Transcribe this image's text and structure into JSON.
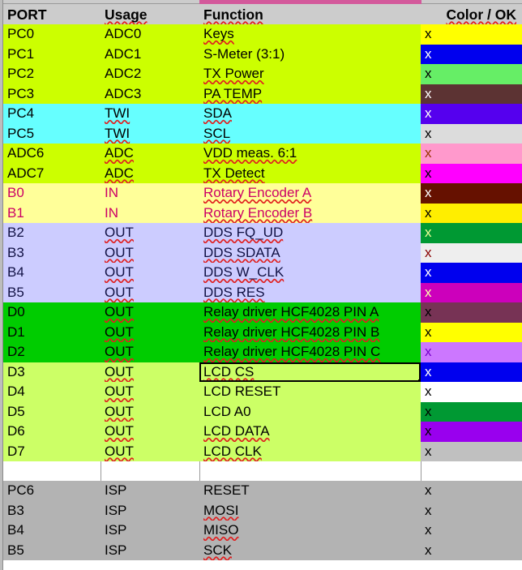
{
  "app": {
    "type": "spreadsheet",
    "selected_cell_text": "LCD CS"
  },
  "header": {
    "port": "PORT",
    "usage": "Usage",
    "function": "Function",
    "color_ok": "Color / OK",
    "bg": "#cccccc",
    "text": "#000000"
  },
  "colors": {
    "column_select_bar": "#d3599b",
    "row_group_adc": "#ccff00",
    "row_group_twi": "#66ffff",
    "row_group_in": "#ffff99",
    "row_group_out_b": "#ccccff",
    "row_group_relay": "#00cc00",
    "row_group_lcd": "#ccff66",
    "row_group_isp": "#b3b3b3",
    "text_crimson": "#cc0066",
    "text_navy": "#111144"
  },
  "ok_mark": "x",
  "rows": [
    {
      "port": "PC0",
      "usage": "ADC0",
      "function": "Keys",
      "row_bg": "#ccff00",
      "row_fg": "#000000",
      "ok_bg": "#ffff00",
      "ok_fg": "#000000",
      "sp_usage": false,
      "sp_func": true
    },
    {
      "port": "PC1",
      "usage": "ADC1",
      "function": "S-Meter (3:1)",
      "row_bg": "#ccff00",
      "row_fg": "#000000",
      "ok_bg": "#0000ee",
      "ok_fg": "#ffffff",
      "sp_usage": false,
      "sp_func": false
    },
    {
      "port": "PC2",
      "usage": "ADC2",
      "function": "TX Power",
      "row_bg": "#ccff00",
      "row_fg": "#000000",
      "ok_bg": "#66ee66",
      "ok_fg": "#000000",
      "sp_usage": false,
      "sp_func": true
    },
    {
      "port": "PC3",
      "usage": "ADC3",
      "function": "PA TEMP",
      "row_bg": "#ccff00",
      "row_fg": "#000000",
      "ok_bg": "#5c3333",
      "ok_fg": "#ffffff",
      "sp_usage": false,
      "sp_func": true
    },
    {
      "port": "PC4",
      "usage": "TWI",
      "function": "SDA",
      "row_bg": "#66ffff",
      "row_fg": "#000000",
      "ok_bg": "#5500ee",
      "ok_fg": "#ffffff",
      "sp_usage": true,
      "sp_func": true
    },
    {
      "port": "PC5",
      "usage": "TWI",
      "function": "SCL",
      "row_bg": "#66ffff",
      "row_fg": "#000000",
      "ok_bg": "#dcdcdc",
      "ok_fg": "#000000",
      "sp_usage": true,
      "sp_func": true
    },
    {
      "port": "ADC6",
      "usage": "ADC",
      "function": "VDD meas. 6:1",
      "row_bg": "#ccff00",
      "row_fg": "#000000",
      "ok_bg": "#ff99cc",
      "ok_fg": "#993300",
      "sp_usage": true,
      "sp_func": true
    },
    {
      "port": "ADC7",
      "usage": "ADC",
      "function": "TX Detect",
      "row_bg": "#ccff00",
      "row_fg": "#000000",
      "ok_bg": "#ff00ff",
      "ok_fg": "#000000",
      "sp_usage": true,
      "sp_func": true
    },
    {
      "port": "B0",
      "usage": "IN",
      "function": "Rotary Encoder A",
      "row_bg": "#ffff99",
      "row_fg": "#cc0066",
      "ok_bg": "#661100",
      "ok_fg": "#ffffff",
      "sp_usage": false,
      "sp_func": true
    },
    {
      "port": "B1",
      "usage": "IN",
      "function": "Rotary Encoder B",
      "row_bg": "#ffff99",
      "row_fg": "#cc0066",
      "ok_bg": "#ffee00",
      "ok_fg": "#000000",
      "sp_usage": false,
      "sp_func": true
    },
    {
      "port": "B2",
      "usage": "OUT",
      "function": "DDS FQ_UD",
      "row_bg": "#ccccff",
      "row_fg": "#111144",
      "ok_bg": "#009933",
      "ok_fg": "#eeff99",
      "sp_usage": true,
      "sp_func": true
    },
    {
      "port": "B3",
      "usage": "OUT",
      "function": "DDS SDATA",
      "row_bg": "#ccccff",
      "row_fg": "#111144",
      "ok_bg": "#eeeeee",
      "ok_fg": "#880000",
      "sp_usage": true,
      "sp_func": true
    },
    {
      "port": "B4",
      "usage": "OUT",
      "function": "DDS W_CLK",
      "row_bg": "#ccccff",
      "row_fg": "#111144",
      "ok_bg": "#0000ee",
      "ok_fg": "#ffffff",
      "sp_usage": true,
      "sp_func": true
    },
    {
      "port": "B5",
      "usage": "OUT",
      "function": "DDS RES",
      "row_bg": "#ccccff",
      "row_fg": "#111144",
      "ok_bg": "#cc00bb",
      "ok_fg": "#ffffaa",
      "sp_usage": true,
      "sp_func": true
    },
    {
      "port": "D0",
      "usage": "OUT",
      "function": "Relay driver HCF4028 PIN A",
      "row_bg": "#00cc00",
      "row_fg": "#000000",
      "ok_bg": "#773355",
      "ok_fg": "#000000",
      "sp_usage": true,
      "sp_func": true
    },
    {
      "port": "D1",
      "usage": "OUT",
      "function": "Relay driver HCF4028 PIN B",
      "row_bg": "#00cc00",
      "row_fg": "#000000",
      "ok_bg": "#ffff00",
      "ok_fg": "#000000",
      "sp_usage": true,
      "sp_func": true
    },
    {
      "port": "D2",
      "usage": "OUT",
      "function": "Relay driver HCF4028 PIN C",
      "row_bg": "#00cc00",
      "row_fg": "#000000",
      "ok_bg": "#cc77ff",
      "ok_fg": "#7700cc",
      "sp_usage": true,
      "sp_func": true
    },
    {
      "port": "D3",
      "usage": "OUT",
      "function": "LCD CS",
      "row_bg": "#ccff66",
      "row_fg": "#000000",
      "ok_bg": "#0000ee",
      "ok_fg": "#ffffff",
      "sp_usage": true,
      "sp_func": true,
      "selected": true
    },
    {
      "port": "D4",
      "usage": "OUT",
      "function": "LCD RESET",
      "row_bg": "#ccff66",
      "row_fg": "#000000",
      "ok_bg": "#ffffff",
      "ok_fg": "#000000",
      "sp_usage": true,
      "sp_func": false
    },
    {
      "port": "D5",
      "usage": "OUT",
      "function": "LCD A0",
      "row_bg": "#ccff66",
      "row_fg": "#000000",
      "ok_bg": "#009933",
      "ok_fg": "#000000",
      "sp_usage": true,
      "sp_func": false
    },
    {
      "port": "D6",
      "usage": "OUT",
      "function": "LCD DATA",
      "row_bg": "#ccff66",
      "row_fg": "#000000",
      "ok_bg": "#9900ee",
      "ok_fg": "#000000",
      "sp_usage": true,
      "sp_func": true
    },
    {
      "port": "D7",
      "usage": "OUT",
      "function": "LCD CLK",
      "row_bg": "#ccff66",
      "row_fg": "#000000",
      "ok_bg": "#c0c0c0",
      "ok_fg": "#000000",
      "sp_usage": true,
      "sp_func": true
    },
    {
      "blank": true
    },
    {
      "port": "PC6",
      "usage": "ISP",
      "function": "RESET",
      "row_bg": "#b3b3b3",
      "row_fg": "#000000",
      "ok_bg": "#b3b3b3",
      "ok_fg": "#000000",
      "sp_usage": false,
      "sp_func": false
    },
    {
      "port": "B3",
      "usage": "ISP",
      "function": "MOSI",
      "row_bg": "#b3b3b3",
      "row_fg": "#000000",
      "ok_bg": "#b3b3b3",
      "ok_fg": "#000000",
      "sp_usage": false,
      "sp_func": true
    },
    {
      "port": "B4",
      "usage": "ISP",
      "function": "MISO",
      "row_bg": "#b3b3b3",
      "row_fg": "#000000",
      "ok_bg": "#b3b3b3",
      "ok_fg": "#000000",
      "sp_usage": false,
      "sp_func": true
    },
    {
      "port": "B5",
      "usage": "ISP",
      "function": "SCK",
      "row_bg": "#b3b3b3",
      "row_fg": "#000000",
      "ok_bg": "#b3b3b3",
      "ok_fg": "#000000",
      "sp_usage": false,
      "sp_func": true
    }
  ]
}
